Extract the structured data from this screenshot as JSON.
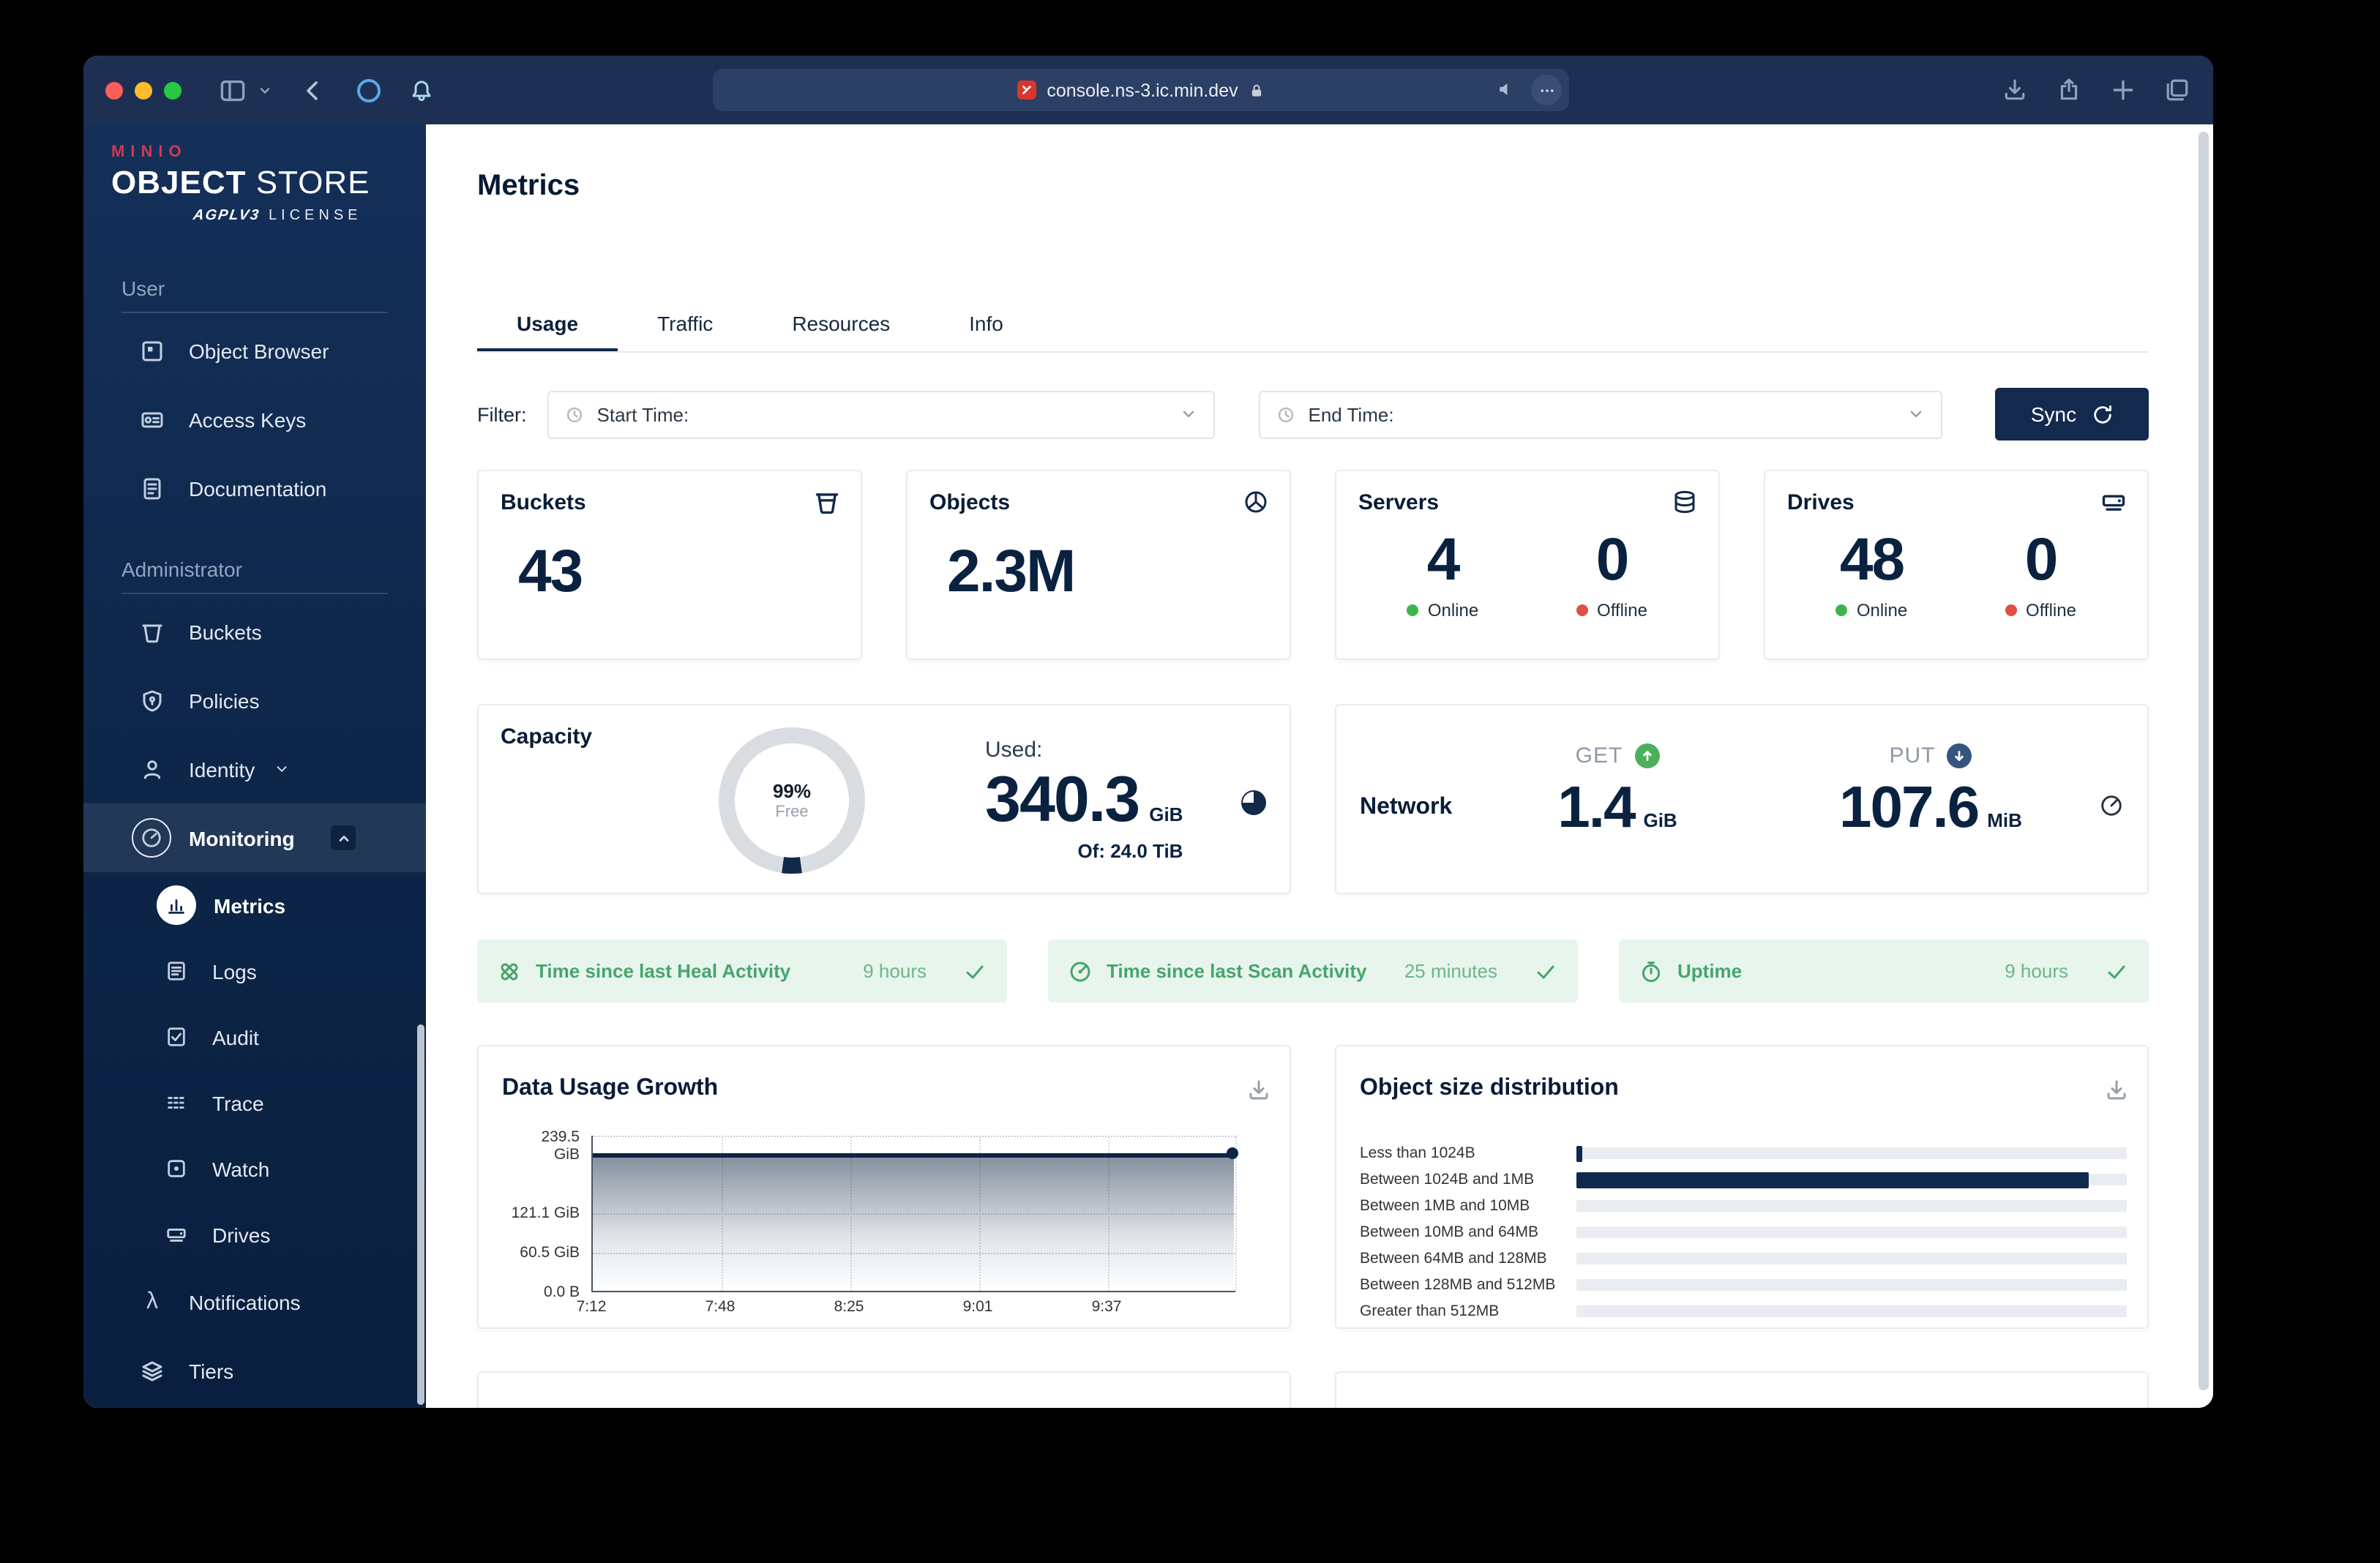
{
  "browser": {
    "url": "console.ns-3.ic.min.dev"
  },
  "sidebar": {
    "brand": "MINIO",
    "title_bold": "OBJECT",
    "title_light": "STORE",
    "license_badge": "AGPLV3",
    "license_label": "LICENSE",
    "section_user": "User",
    "section_admin": "Administrator",
    "items": {
      "object_browser": "Object Browser",
      "access_keys": "Access Keys",
      "documentation": "Documentation",
      "buckets": "Buckets",
      "policies": "Policies",
      "identity": "Identity",
      "monitoring": "Monitoring",
      "metrics": "Metrics",
      "logs": "Logs",
      "audit": "Audit",
      "trace": "Trace",
      "watch": "Watch",
      "drives": "Drives",
      "notifications": "Notifications",
      "tiers": "Tiers"
    }
  },
  "page": {
    "title": "Metrics"
  },
  "tabs": {
    "usage": "Usage",
    "traffic": "Traffic",
    "resources": "Resources",
    "info": "Info"
  },
  "filter": {
    "label": "Filter:",
    "start_label": "Start Time:",
    "end_label": "End Time:",
    "sync": "Sync"
  },
  "summary": {
    "buckets": {
      "title": "Buckets",
      "value": "43"
    },
    "objects": {
      "title": "Objects",
      "value": "2.3M"
    },
    "servers": {
      "title": "Servers",
      "online": "4",
      "online_label": "Online",
      "offline": "0",
      "offline_label": "Offline"
    },
    "drives": {
      "title": "Drives",
      "online": "48",
      "online_label": "Online",
      "offline": "0",
      "offline_label": "Offline"
    }
  },
  "capacity": {
    "title": "Capacity",
    "donut_value": "99%",
    "donut_label": "Free",
    "used_label": "Used:",
    "used_value": "340.3",
    "used_unit": "GiB",
    "total": "Of: 24.0 TiB"
  },
  "network": {
    "title": "Network",
    "get_label": "GET",
    "get_value": "1.4",
    "get_unit": "GiB",
    "put_label": "PUT",
    "put_value": "107.6",
    "put_unit": "MiB"
  },
  "status_banners": {
    "heal": {
      "label": "Time since last Heal Activity",
      "value": "9 hours"
    },
    "scan": {
      "label": "Time since last Scan Activity",
      "value": "25 minutes"
    },
    "uptime": {
      "label": "Uptime",
      "value": "9 hours"
    }
  },
  "usage_chart": {
    "title": "Data Usage Growth",
    "y0a": "239.5",
    "y0b": "GiB",
    "y1": "121.1 GiB",
    "y2": "60.5 GiB",
    "y3": "0.0 B",
    "x": [
      "7:12",
      "7:48",
      "8:25",
      "9:01",
      "9:37"
    ]
  },
  "size_chart": {
    "title": "Object size distribution",
    "rows": [
      {
        "label": "Less than 1024B",
        "pct": 1
      },
      {
        "label": "Between 1024B and 1MB",
        "pct": 93
      },
      {
        "label": "Between 1MB and 10MB",
        "pct": 0
      },
      {
        "label": "Between 10MB and 64MB",
        "pct": 0
      },
      {
        "label": "Between 64MB and 128MB",
        "pct": 0
      },
      {
        "label": "Between 128MB and 512MB",
        "pct": 0
      },
      {
        "label": "Greater than 512MB",
        "pct": 0
      }
    ]
  },
  "chart_data": [
    {
      "type": "area",
      "title": "Data Usage Growth",
      "x": [
        "7:12",
        "7:48",
        "8:25",
        "9:01",
        "9:37"
      ],
      "series": [
        {
          "name": "Data Usage",
          "values": [
            235,
            235,
            235,
            235,
            235
          ]
        }
      ],
      "ylabel": "GiB",
      "ylim": [
        0,
        239.5
      ],
      "yticks": [
        "0.0 B",
        "60.5 GiB",
        "121.1 GiB",
        "239.5 GiB"
      ],
      "grid": true,
      "legend": false
    },
    {
      "type": "bar",
      "orientation": "horizontal",
      "title": "Object size distribution",
      "categories": [
        "Less than 1024B",
        "Between 1024B and 1MB",
        "Between 1MB and 10MB",
        "Between 10MB and 64MB",
        "Between 64MB and 128MB",
        "Between 128MB and 512MB",
        "Greater than 512MB"
      ],
      "values_pct": [
        1,
        93,
        0,
        0,
        0,
        0,
        0
      ],
      "xlim": [
        0,
        100
      ],
      "grid": false
    }
  ],
  "colors": {
    "accent_navy": "#102a4d",
    "sidebar_top": "#143059",
    "green_online": "#3bb54a",
    "red_offline": "#e04f44",
    "banner_green": "#47a56d",
    "minio_red": "#d13a51"
  }
}
